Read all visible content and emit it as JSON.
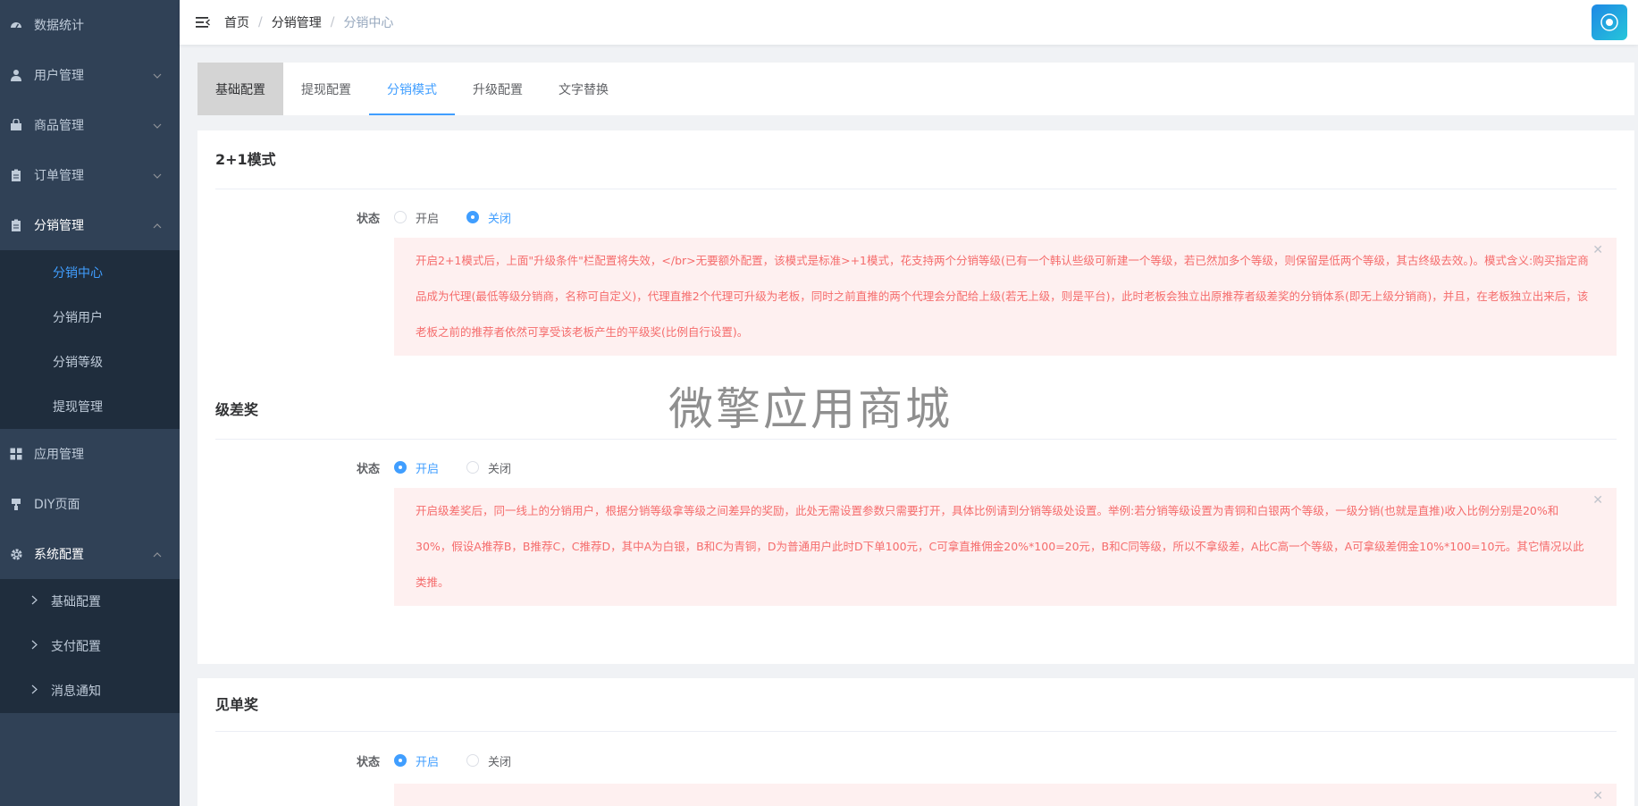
{
  "sidebar": {
    "items": [
      {
        "label": "数据统计",
        "icon": "dashboard-icon",
        "has_arrow": false
      },
      {
        "label": "用户管理",
        "icon": "user-icon",
        "has_arrow": true
      },
      {
        "label": "商品管理",
        "icon": "shopping-bag-icon",
        "has_arrow": true
      },
      {
        "label": "订单管理",
        "icon": "clipboard-icon",
        "has_arrow": true
      },
      {
        "label": "分销管理",
        "icon": "clipboard-icon",
        "has_arrow": true,
        "open": true
      }
    ],
    "distribution_sub": [
      {
        "label": "分销中心",
        "active": true
      },
      {
        "label": "分销用户"
      },
      {
        "label": "分销等级"
      },
      {
        "label": "提现管理"
      }
    ],
    "items2": [
      {
        "label": "应用管理",
        "icon": "grid-icon"
      },
      {
        "label": "DIY页面",
        "icon": "paint-roller-icon"
      },
      {
        "label": "系统配置",
        "icon": "gear-icon",
        "open": true
      }
    ],
    "system_sub": [
      {
        "label": "基础配置"
      },
      {
        "label": "支付配置"
      },
      {
        "label": "消息通知"
      }
    ]
  },
  "header": {
    "breadcrumb": [
      "首页",
      "分销管理",
      "分销中心"
    ],
    "separator": "/"
  },
  "tabs": [
    "基础配置",
    "提现配置",
    "分销模式",
    "升级配置",
    "文字替换"
  ],
  "sections": {
    "two_plus_one": {
      "title": "2+1模式",
      "status_label": "状态",
      "options": [
        "开启",
        "关闭"
      ],
      "selected": "关闭",
      "notice": "开启2+1模式后，上面\"升级条件\"栏配置将失效，</br>无要额外配置，该模式是标准>+1模式，花支持两个分销等级(已有一个韩认些级可新建一个等级，若已然加多个等级，则保留是低两个等级，其古终级去效。)。模式含义:购买指定商品成为代理(最低等级分销商，名称可自定义)，代理直推2个代理可升级为老板，同时之前直推的两个代理会分配给上级(若无上级，则是平台)，此时老板会独立出原推荐者级差奖的分销体系(即无上级分销商)，并且，在老板独立出来后，该老板之前的推荐者依然可享受该老板产生的平级奖(比例自行设置)。"
    },
    "level_diff": {
      "title": "级差奖",
      "status_label": "状态",
      "options": [
        "开启",
        "关闭"
      ],
      "selected": "开启",
      "notice": "开启级差奖后，同一线上的分销用户，根据分销等级拿等级之间差异的奖励，此处无需设置参数只需要打开，具体比例请到分销等级处设置。举例:若分销等级设置为青铜和白银两个等级，一级分销(也就是直推)收入比例分别是20%和30%，假设A推荐B，B推荐C，C推荐D，其中A为白银，B和C为青铜，D为普通用户此时D下单100元，C可拿直推佣金20%*100=20元，B和C同等级，所以不拿级差，A比C高一个等级，A可拿级差佣金10%*100=10元。其它情况以此类推。"
    },
    "see_order": {
      "title": "见单奖",
      "status_label": "状态",
      "options": [
        "开启",
        "关闭"
      ],
      "selected": "开启"
    }
  },
  "watermark": "微擎应用商城",
  "colors": {
    "sidebar_bg": "#304156",
    "submenu_bg": "#1f2d3d",
    "accent": "#409eff",
    "alert_text": "#f56c6c",
    "alert_bg": "#fef0f0"
  }
}
